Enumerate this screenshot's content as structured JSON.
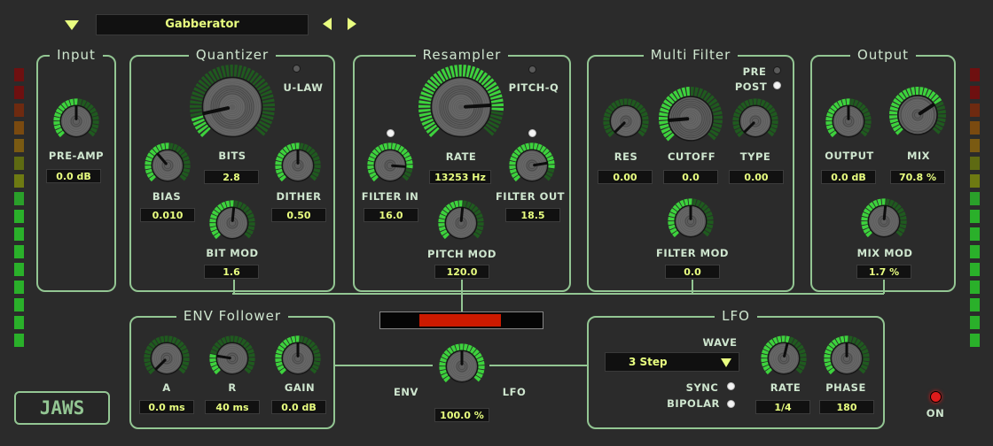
{
  "header": {
    "preset_name": "Gabberator",
    "menu_icon": "triangle-down-icon",
    "prev_icon": "triangle-left-icon",
    "next_icon": "triangle-right-icon"
  },
  "colors": {
    "accent": "#e9ff80",
    "panel_border": "#93c693",
    "knob_arc": "#3dd23d",
    "background": "#2b2b2b",
    "env_bar": "#cc1a00",
    "power_led": "#e01b1b"
  },
  "input": {
    "title": "Input",
    "pre_amp": {
      "label": "PRE-AMP",
      "value": "0.0 dB"
    }
  },
  "quantizer": {
    "title": "Quantizer",
    "ulaw_label": "U-LAW",
    "bits": {
      "label": "BITS",
      "value": "2.8"
    },
    "bias": {
      "label": "BIAS",
      "value": "0.010"
    },
    "dither": {
      "label": "DITHER",
      "value": "0.50"
    },
    "bit_mod": {
      "label": "BIT MOD",
      "value": "1.6"
    }
  },
  "resampler": {
    "title": "Resampler",
    "pitchq_label": "PITCH-Q",
    "rate": {
      "label": "RATE",
      "value": "13253 Hz"
    },
    "filter_in": {
      "label": "FILTER IN",
      "value": "16.0"
    },
    "filter_out": {
      "label": "FILTER OUT",
      "value": "18.5"
    },
    "pitch_mod": {
      "label": "PITCH MOD",
      "value": "120.0"
    }
  },
  "multi_filter": {
    "title": "Multi Filter",
    "pre_label": "PRE",
    "post_label": "POST",
    "res": {
      "label": "RES",
      "value": "0.00"
    },
    "cutoff": {
      "label": "CUTOFF",
      "value": "0.0"
    },
    "type": {
      "label": "TYPE",
      "value": "0.00"
    },
    "filter_mod": {
      "label": "FILTER MOD",
      "value": "0.0"
    }
  },
  "output": {
    "title": "Output",
    "output": {
      "label": "OUTPUT",
      "value": "0.0 dB"
    },
    "mix": {
      "label": "MIX",
      "value": "70.8 %"
    },
    "mix_mod": {
      "label": "MIX MOD",
      "value": "1.7 %"
    }
  },
  "env_follower": {
    "title": "ENV Follower",
    "a": {
      "label": "A",
      "value": "0.0 ms"
    },
    "r": {
      "label": "R",
      "value": "40 ms"
    },
    "gain": {
      "label": "GAIN",
      "value": "0.0 dB"
    }
  },
  "env_lfo": {
    "env_label": "ENV",
    "lfo_label": "LFO",
    "value": "100.0 %"
  },
  "lfo": {
    "title": "LFO",
    "wave_label": "WAVE",
    "wave_value": "3 Step",
    "sync_label": "SYNC",
    "bipolar_label": "BIPOLAR",
    "rate": {
      "label": "RATE",
      "value": "1/4"
    },
    "phase": {
      "label": "PHASE",
      "value": "180"
    }
  },
  "logo": "JAWS",
  "power_label": "ON"
}
